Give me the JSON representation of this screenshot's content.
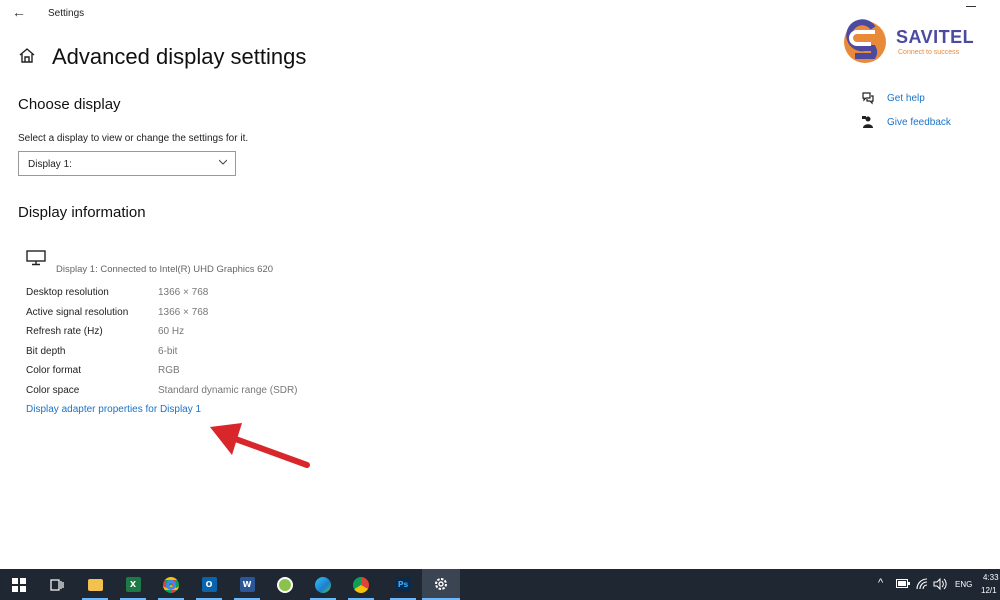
{
  "window": {
    "title": "Settings"
  },
  "logo": {
    "name": "SAVITEL",
    "tagline": "Connect to success"
  },
  "page": {
    "title": "Advanced display settings"
  },
  "choose_display": {
    "heading": "Choose display",
    "description": "Select a display to view or change the settings for it.",
    "selected": "Display 1:"
  },
  "display_info": {
    "heading": "Display information",
    "connection": "Display 1: Connected to Intel(R) UHD Graphics 620",
    "rows": [
      {
        "label": "Desktop resolution",
        "value": "1366 × 768"
      },
      {
        "label": "Active signal resolution",
        "value": "1366 × 768"
      },
      {
        "label": "Refresh rate (Hz)",
        "value": "60 Hz"
      },
      {
        "label": "Bit depth",
        "value": "6-bit"
      },
      {
        "label": "Color format",
        "value": "RGB"
      },
      {
        "label": "Color space",
        "value": "Standard dynamic range (SDR)"
      }
    ],
    "adapter_link": "Display adapter properties for Display 1"
  },
  "side_links": {
    "get_help": "Get help",
    "give_feedback": "Give feedback"
  },
  "taskbar": {
    "apps": [
      "start-icon",
      "task-view-icon",
      "file-explorer-icon",
      "excel-icon",
      "chrome-icon",
      "outlook-icon",
      "word-icon",
      "app-icon",
      "edge-icon",
      "chrome-icon",
      "photoshop-icon",
      "settings-icon"
    ],
    "tray": {
      "language": "ENG",
      "time": "4:33",
      "date": "12/1"
    }
  },
  "colors": {
    "link": "#1a73c8",
    "taskbar": "#1f2733",
    "arrow": "#d9262b",
    "logo_primary": "#4b4aa0",
    "logo_accent": "#e88a3a"
  }
}
